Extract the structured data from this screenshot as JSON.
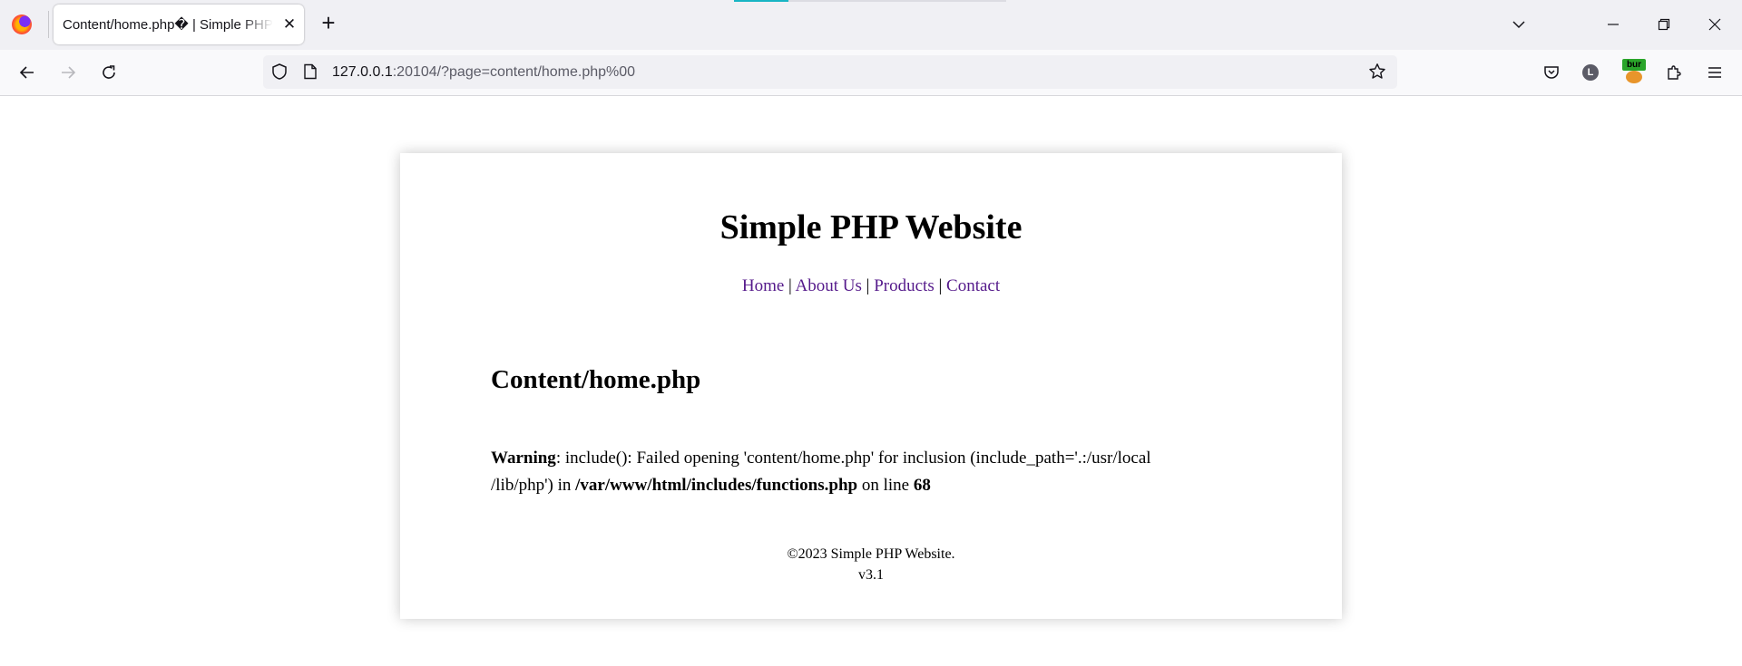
{
  "browser": {
    "tab": {
      "title": "Content/home.php� | Simple PHP Website"
    },
    "url": {
      "host": "127.0.0.1",
      "rest": ":20104/?page=content/home.php%00"
    },
    "extensions": {
      "profile_letter": "L",
      "burp_label": "bur"
    }
  },
  "site": {
    "title": "Simple PHP Website",
    "nav": [
      {
        "label": "Home"
      },
      {
        "label": "About Us"
      },
      {
        "label": "Products"
      },
      {
        "label": "Contact"
      }
    ],
    "nav_separator": " | ",
    "content_title": "Content/home.php",
    "warning": {
      "label": "Warning",
      "text_1": ": include(): Failed opening 'content/home.php' for inclusion (include_path='.:/usr/local",
      "text_2": "/lib/php') in ",
      "file": "/var/www/html/includes/functions.php",
      "text_3": " on line ",
      "line": "68"
    },
    "footer": {
      "copyright": "©2023 Simple PHP Website.",
      "version": "v3.1"
    }
  },
  "colors": {
    "link": "#551a8b",
    "tab_accent": "#18b5c4"
  }
}
